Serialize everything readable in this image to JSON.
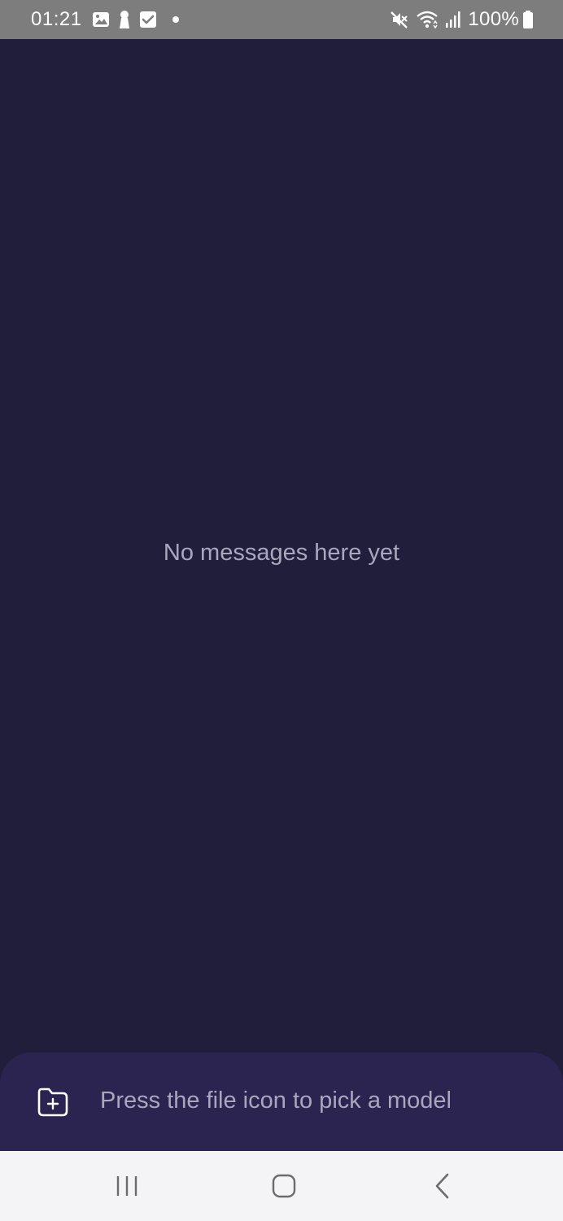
{
  "status_bar": {
    "time": "01:21",
    "battery": "100%",
    "notification_icons": [
      "image-icon",
      "keyhole-icon",
      "checkbox-icon",
      "dot-icon"
    ],
    "system_icons": [
      "mute-icon",
      "wifi-icon",
      "signal-icon",
      "battery-icon"
    ]
  },
  "chat": {
    "empty_message": "No messages here yet"
  },
  "input": {
    "file_icon": "folder-plus-icon",
    "hint": "Press the file icon to pick a model"
  },
  "nav_bar": {
    "buttons": [
      "recents-icon",
      "home-icon",
      "back-icon"
    ]
  },
  "colors": {
    "background": "#201e3a",
    "input_bar": "#2b2350",
    "status_bar": "#7d7d7d",
    "muted_text": "#a9a6bd",
    "nav_bar": "#f4f4f6"
  }
}
